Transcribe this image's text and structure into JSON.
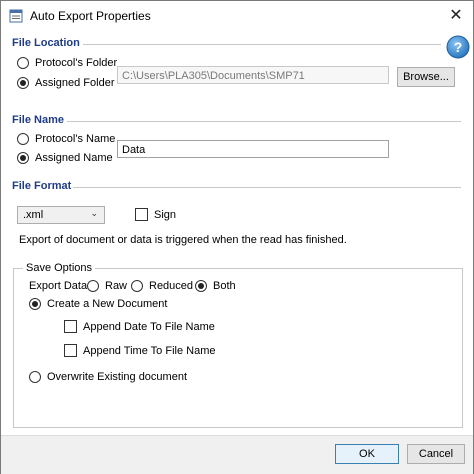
{
  "window": {
    "title": "Auto Export Properties",
    "close_glyph": "✕",
    "help_glyph": "?"
  },
  "file_location": {
    "heading": "File Location",
    "options": [
      "Protocol's Folder",
      "Assigned Folder"
    ],
    "selected": "Assigned Folder",
    "path_value": "C:\\Users\\PLA305\\Documents\\SMP71",
    "browse_label": "Browse..."
  },
  "file_name": {
    "heading": "File Name",
    "options": [
      "Protocol's Name",
      "Assigned Name"
    ],
    "selected": "Assigned Name",
    "name_value": "Data"
  },
  "file_format": {
    "heading": "File Format",
    "format_value": ".xml",
    "dropdown_glyph": "⌄",
    "sign_label": "Sign",
    "sign_checked": false,
    "info_text": "Export of document or data is triggered when the read has finished."
  },
  "save_options": {
    "heading": "Save Options",
    "export_data_label": "Export Data:",
    "export_data_options": [
      "Raw",
      "Reduced",
      "Both"
    ],
    "export_data_selected": "Both",
    "create_new_label": "Create a New Document",
    "append_date_label": "Append Date To File Name",
    "append_time_label": "Append Time To File Name",
    "overwrite_label": "Overwrite Existing document",
    "mode_selected": "Create a New Document"
  },
  "footer": {
    "ok_label": "OK",
    "cancel_label": "Cancel"
  },
  "colors": {
    "heading": "#1f3c88",
    "help_button": "#3f8fd6"
  }
}
